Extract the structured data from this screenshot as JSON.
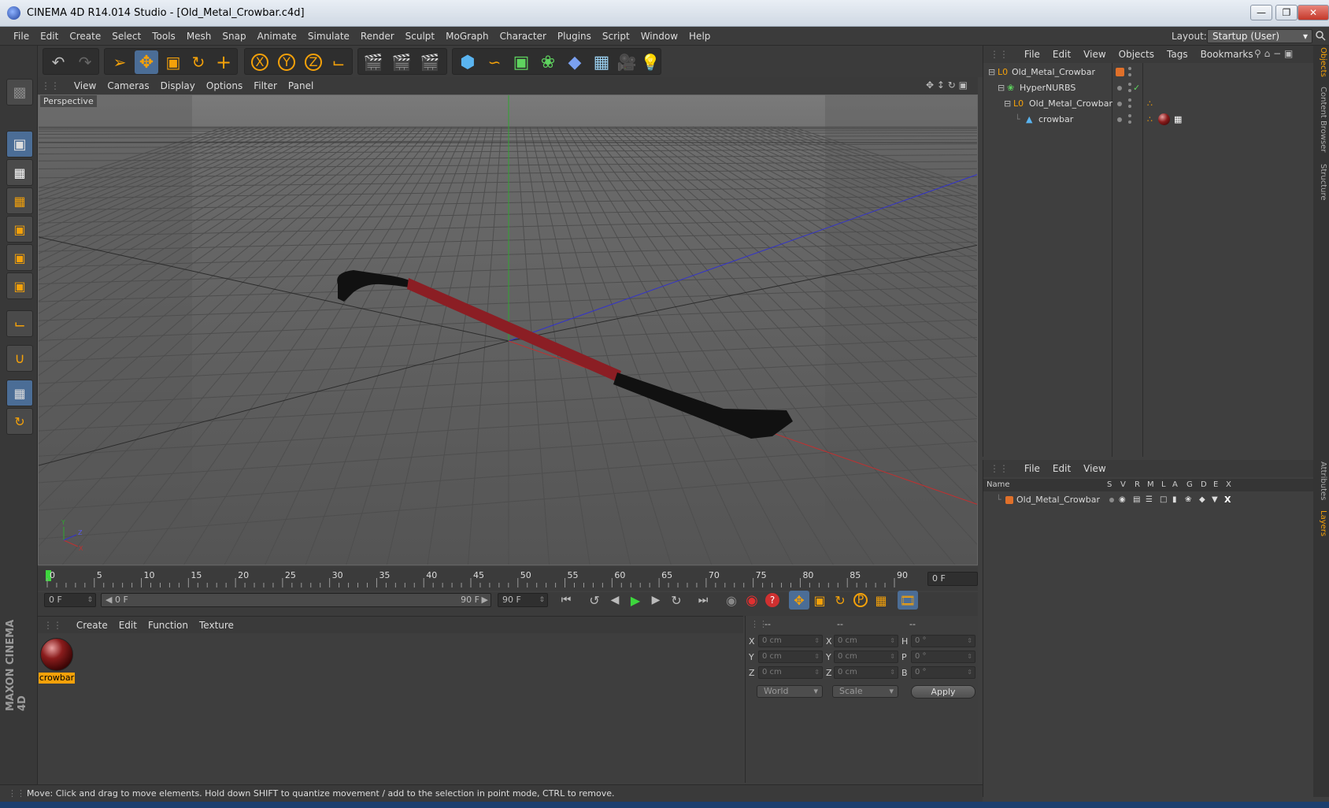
{
  "window": {
    "title": "CINEMA 4D R14.014 Studio - [Old_Metal_Crowbar.c4d]",
    "min_icon": "minimize-icon",
    "max_icon": "maximize-icon",
    "close_icon": "close-icon"
  },
  "menubar": {
    "items": [
      "File",
      "Edit",
      "Create",
      "Select",
      "Tools",
      "Mesh",
      "Snap",
      "Animate",
      "Simulate",
      "Render",
      "Sculpt",
      "MoGraph",
      "Character",
      "Plugins",
      "Script",
      "Window",
      "Help"
    ],
    "layout_label": "Layout:",
    "layout_value": "Startup (User)"
  },
  "viewport": {
    "menu": [
      "View",
      "Cameras",
      "Display",
      "Options",
      "Filter",
      "Panel"
    ],
    "label": "Perspective",
    "axis_y": "Y",
    "axis_x": "X",
    "axis_z": "Z"
  },
  "timeline": {
    "ticks": [
      "0",
      "5",
      "10",
      "15",
      "20",
      "25",
      "30",
      "35",
      "40",
      "45",
      "50",
      "55",
      "60",
      "65",
      "70",
      "75",
      "80",
      "85",
      "90"
    ],
    "current_frame": "0 F"
  },
  "transport": {
    "start_field": "0 F",
    "range_start": "0 F",
    "range_end": "90 F",
    "end_field": "90 F"
  },
  "material_manager": {
    "menu": [
      "Create",
      "Edit",
      "Function",
      "Texture"
    ],
    "material_name": "crowbar"
  },
  "coordinates": {
    "header": [
      "--",
      "--",
      "--"
    ],
    "pos_labels": [
      "X",
      "Y",
      "Z"
    ],
    "pos_values": [
      "0 cm",
      "0 cm",
      "0 cm"
    ],
    "size_labels": [
      "X",
      "Y",
      "Z"
    ],
    "size_values": [
      "0 cm",
      "0 cm",
      "0 cm"
    ],
    "rot_labels": [
      "H",
      "P",
      "B"
    ],
    "rot_values": [
      "0 °",
      "0 °",
      "0 °"
    ],
    "mode_world": "World",
    "mode_scale": "Scale",
    "apply": "Apply"
  },
  "status": {
    "text": "Move: Click and drag to move elements. Hold down SHIFT to quantize movement / add to the selection in point mode, CTRL to remove."
  },
  "object_manager": {
    "menu": [
      "File",
      "Edit",
      "View",
      "Objects",
      "Tags",
      "Bookmarks"
    ],
    "objects": [
      {
        "name": "Old_Metal_Crowbar"
      },
      {
        "name": "HyperNURBS"
      },
      {
        "name": "Old_Metal_Crowbar"
      },
      {
        "name": "crowbar"
      }
    ]
  },
  "layer_manager": {
    "menu": [
      "File",
      "Edit",
      "View"
    ],
    "columns": [
      "Name",
      "S",
      "V",
      "R",
      "M",
      "L",
      "A",
      "G",
      "D",
      "E",
      "X"
    ],
    "layer_name": "Old_Metal_Crowbar",
    "layer_color": "#e0702a"
  },
  "side_tabs": [
    "Objects",
    "Content Browser",
    "Structure",
    "Attributes",
    "Layers"
  ],
  "brand": {
    "logo_text": "MAXON CINEMA 4D"
  },
  "colors": {
    "accent": "#f4a10a",
    "active_tool": "#4b6d96",
    "crowbar_red": "#8b1e24"
  }
}
